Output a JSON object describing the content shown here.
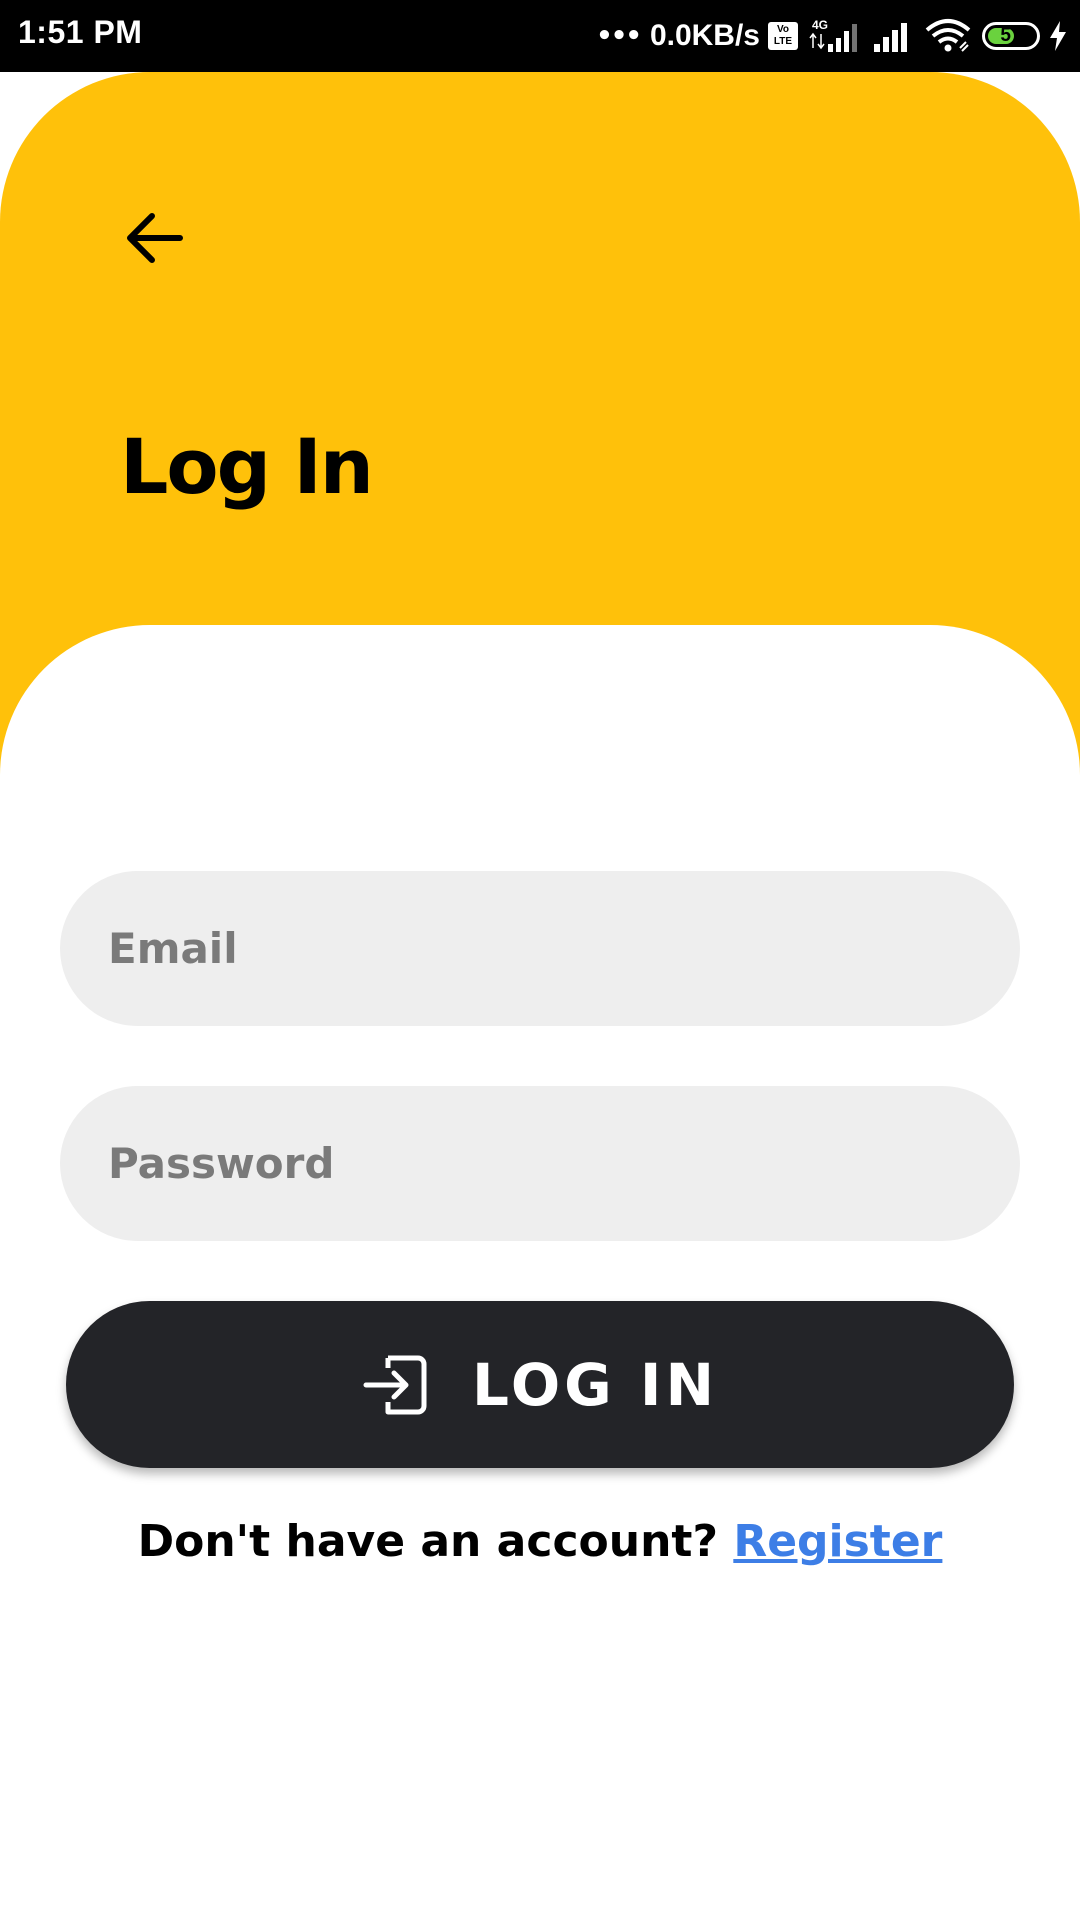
{
  "status_bar": {
    "time": "1:51 PM",
    "dots": "•••",
    "network_speed": "0.0KB/s",
    "volte_top": "Vo",
    "volte_bottom": "LTE",
    "network_type": "4G",
    "battery_percent": "57",
    "battery_level": 0.57,
    "icons": [
      "volte-icon",
      "signal-icon",
      "signal-icon",
      "wifi-icon",
      "battery-icon",
      "charging-icon"
    ]
  },
  "header": {
    "back_icon": "arrow-left-icon",
    "title": "Log In"
  },
  "form": {
    "email_placeholder": "Email",
    "email_value": "",
    "password_placeholder": "Password",
    "password_value": "",
    "login_icon": "login-icon",
    "login_label": "LOG IN"
  },
  "footer": {
    "prompt": "Don't have an account?",
    "register_label": "Register"
  },
  "colors": {
    "header_bg": "#FFC10A",
    "button_bg": "#232428",
    "field_bg": "#EEEEEE",
    "link": "#3D7EE6"
  }
}
